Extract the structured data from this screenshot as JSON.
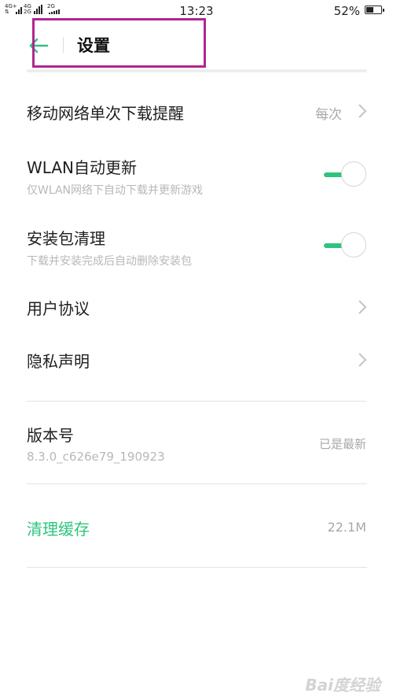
{
  "status_bar": {
    "net1": "4G+",
    "net2_top": "4G",
    "net2_bottom": "2G",
    "net3": "2G",
    "time": "13:23",
    "battery_pct": "52%",
    "battery_level": 0.52
  },
  "header": {
    "back_icon": "arrow-left-icon",
    "title": "设置",
    "accent_color": "#2ec47f",
    "highlight_color": "#b0268e"
  },
  "settings": {
    "mobile_download": {
      "label": "移动网络单次下载提醒",
      "value": "每次"
    },
    "wlan_update": {
      "label": "WLAN自动更新",
      "desc": "仅WLAN网络下自动下载并更新游戏",
      "enabled": true
    },
    "package_clean": {
      "label": "安装包清理",
      "desc": "下载并安装完成后自动删除安装包",
      "enabled": true
    },
    "user_agreement": {
      "label": "用户协议"
    },
    "privacy": {
      "label": "隐私声明"
    },
    "version": {
      "label": "版本号",
      "number": "8.3.0_c626e79_190923",
      "status": "已是最新"
    },
    "clear_cache": {
      "label": "清理缓存",
      "size": "22.1M"
    }
  },
  "watermark": "Bai度经验"
}
